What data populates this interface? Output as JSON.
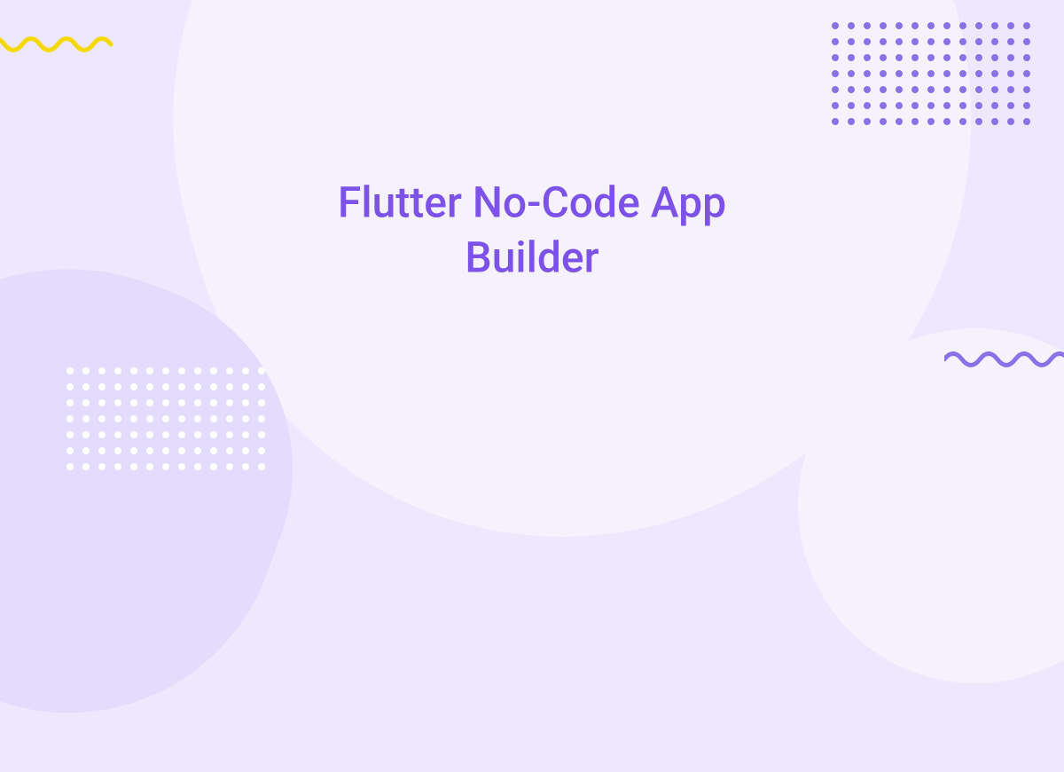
{
  "hero": {
    "title": "Flutter No-Code App Builder"
  },
  "colors": {
    "primary": "#7C52E8",
    "accent_purple": "#8B71E8",
    "accent_yellow": "#F5D900",
    "bg_light": "#F5F2FE",
    "bg_medium": "#EDE8FD",
    "bg_blob": "#E4DCFC",
    "white": "#FFFFFF"
  }
}
